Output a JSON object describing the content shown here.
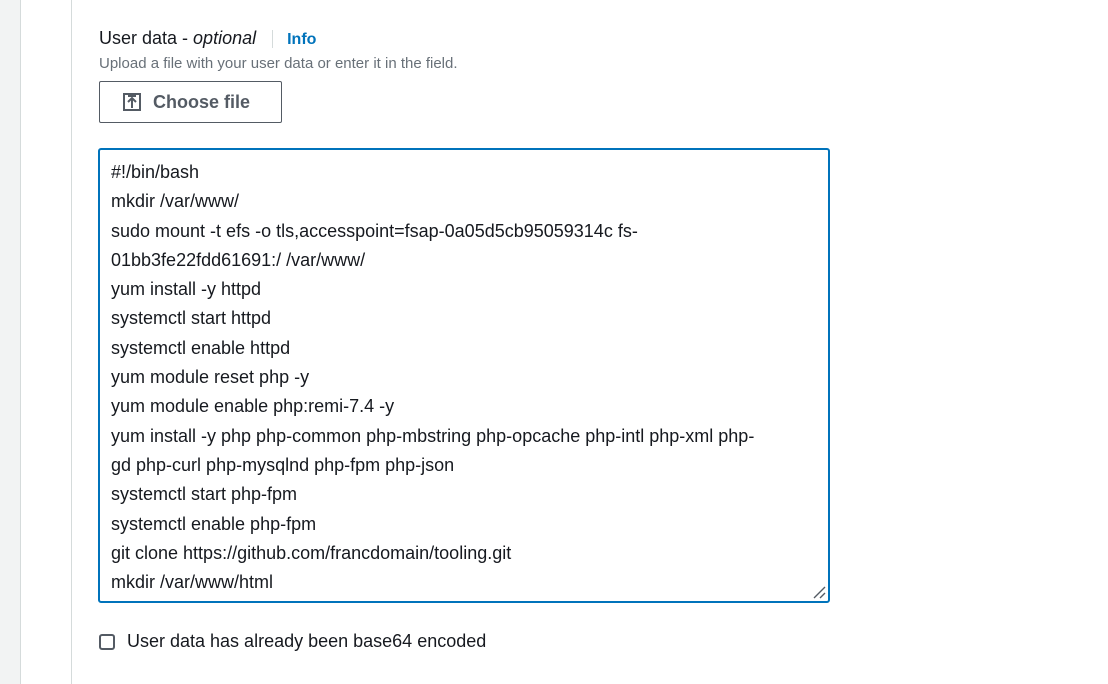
{
  "field": {
    "label": "User data - ",
    "label_optional": "optional",
    "info_link": "Info",
    "description": "Upload a file with your user data or enter it in the field."
  },
  "choose_file": {
    "label": "Choose file",
    "icon": "upload-icon"
  },
  "user_data": {
    "lines": [
      "#!/bin/bash",
      "mkdir /var/www/",
      "sudo mount -t efs -o tls,accesspoint=fsap-0a05d5cb95059314c fs-",
      "01bb3fe22fdd61691:/ /var/www/",
      "yum install -y httpd",
      "systemctl start httpd",
      "systemctl enable httpd",
      "yum module reset php -y",
      "yum module enable php:remi-7.4 -y",
      "yum install -y php php-common php-mbstring php-opcache php-intl php-xml php-",
      "gd php-curl php-mysqlnd php-fpm php-json",
      "systemctl start php-fpm",
      "systemctl enable php-fpm",
      "git clone https://github.com/francdomain/tooling.git",
      "mkdir /var/www/html"
    ]
  },
  "base64_checkbox": {
    "label": "User data has already been base64 encoded",
    "checked": false
  },
  "colors": {
    "accent": "#0073bb",
    "text": "#16191f",
    "secondary_text": "#687078",
    "border": "#545b64"
  }
}
